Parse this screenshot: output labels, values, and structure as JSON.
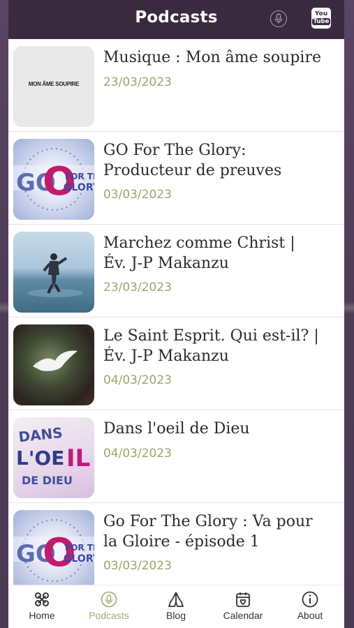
{
  "header": {
    "title": "Podcasts",
    "icons": [
      "podcast-mic-icon",
      "youtube-icon"
    ],
    "youtube_icon_text": {
      "top": "You",
      "bottom": "Tube"
    }
  },
  "episodes": [
    {
      "title_lines": [
        "Musique : Mon âme soupire",
        ""
      ],
      "date": "23/03/2023",
      "thumb_text": "MON ÂME SOUPIRE"
    },
    {
      "title_lines": [
        "GO For The Glory:",
        "Producteur de preuves"
      ],
      "date": "03/03/2023"
    },
    {
      "title_lines": [
        "Marchez comme Christ  |",
        "Év. J-P Makanzu"
      ],
      "date": "23/03/2023"
    },
    {
      "title_lines": [
        "Le Saint Esprit.  Qui est-il? |",
        "Év. J-P Makanzu"
      ],
      "date": "04/03/2023"
    },
    {
      "title_lines": [
        "Dans l'oeil de Dieu",
        ""
      ],
      "date": "04/03/2023"
    },
    {
      "title_lines": [
        "Go For The Glory :  Va pour",
        "la Gloire -  épisode 1"
      ],
      "date": "03/03/2023"
    }
  ],
  "nav": [
    {
      "label": "Home",
      "icon": "home-knot-icon"
    },
    {
      "label": "Podcasts",
      "icon": "podcast-mic-icon",
      "active": true
    },
    {
      "label": "Blog",
      "icon": "praying-hands-icon"
    },
    {
      "label": "Calendar",
      "icon": "calendar-heart-icon"
    },
    {
      "label": "About",
      "icon": "info-icon"
    }
  ],
  "colors": {
    "header_bg": "#3a2a40",
    "date": "#9aa76b",
    "active_tab": "#a4a86b",
    "backdrop": "#4e3c57"
  }
}
